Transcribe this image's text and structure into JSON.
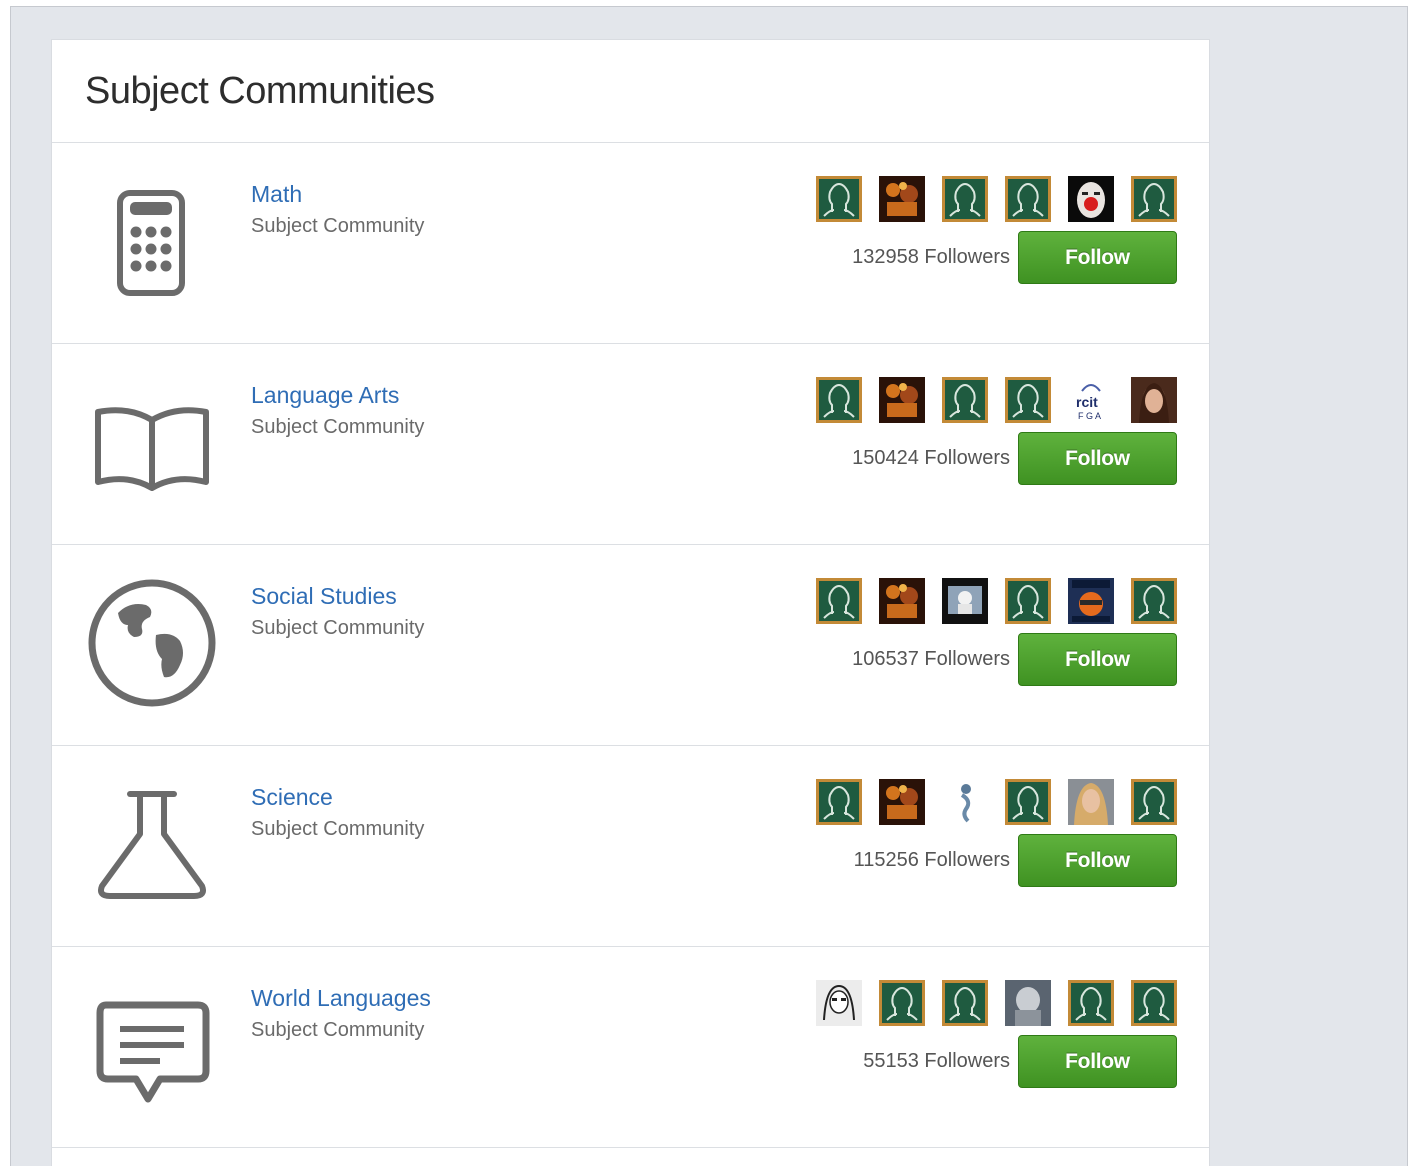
{
  "page": {
    "title": "Subject Communities"
  },
  "colors": {
    "link": "#2f6db5",
    "follow_button": "#4ba22c",
    "background": "#e3e6eb",
    "icon_gray": "#6b6b6b"
  },
  "follow_label": "Follow",
  "communities": [
    {
      "name": "Math",
      "subtitle": "Subject Community",
      "followers": "132958 Followers",
      "icon": "calculator-icon",
      "avatars": [
        "default",
        "photo-warm",
        "default",
        "default",
        "photo-clown",
        "default"
      ]
    },
    {
      "name": "Language Arts",
      "subtitle": "Subject Community",
      "followers": "150424 Followers",
      "icon": "open-book-icon",
      "avatars": [
        "default",
        "photo-warm",
        "default",
        "default",
        "photo-logo",
        "photo-woman"
      ]
    },
    {
      "name": "Social Studies",
      "subtitle": "Subject Community",
      "followers": "106537 Followers",
      "icon": "globe-icon",
      "avatars": [
        "default",
        "photo-warm",
        "photo-dark",
        "default",
        "photo-poster",
        "default"
      ]
    },
    {
      "name": "Science",
      "subtitle": "Subject Community",
      "followers": "115256 Followers",
      "icon": "flask-icon",
      "avatars": [
        "default",
        "photo-warm",
        "photo-figure",
        "default",
        "photo-blonde",
        "default"
      ]
    },
    {
      "name": "World Languages",
      "subtitle": "Subject Community",
      "followers": "55153 Followers",
      "icon": "speech-bubble-icon",
      "avatars": [
        "photo-sketch",
        "default",
        "default",
        "photo-gray",
        "default",
        "default"
      ]
    }
  ]
}
